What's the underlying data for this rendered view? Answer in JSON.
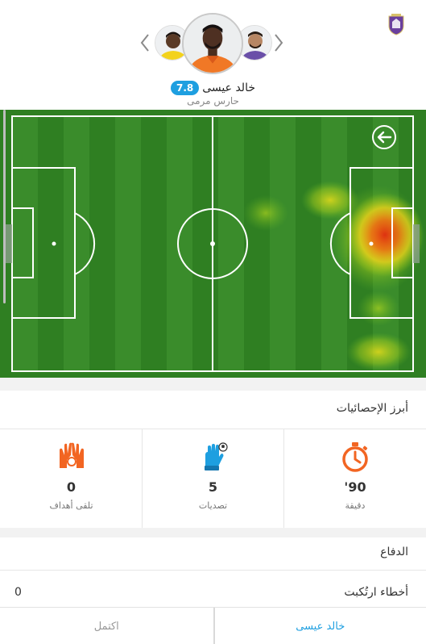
{
  "header": {
    "player_name": "خالد عيسى",
    "rating": "7.8",
    "position": "حارس مرمى",
    "team_logo_icon": "team-crest-icon",
    "prev_icon": "chevron-left-icon",
    "next_icon": "chevron-right-icon"
  },
  "pitch": {
    "back_icon": "arrow-left-icon"
  },
  "stats": {
    "title": "أبرز الإحصائيات",
    "items": [
      {
        "value": "90'",
        "label": "دقيقة",
        "icon": "stopwatch-icon"
      },
      {
        "value": "5",
        "label": "تصديات",
        "icon": "goalkeeper-glove-icon"
      },
      {
        "value": "0",
        "label": "تلقى أهداف",
        "icon": "conceded-goals-icon"
      }
    ]
  },
  "defense": {
    "title": "الدفاع",
    "rows": [
      {
        "label": "أخطاء ارتُكبت",
        "value": "0"
      }
    ]
  },
  "tabs": {
    "lineup": "اكتمل",
    "player": "خالد عيسى"
  },
  "colors": {
    "accent": "#1e9fe0",
    "stat_icon": "#f26522",
    "pitch_green": "#2f7f22"
  }
}
